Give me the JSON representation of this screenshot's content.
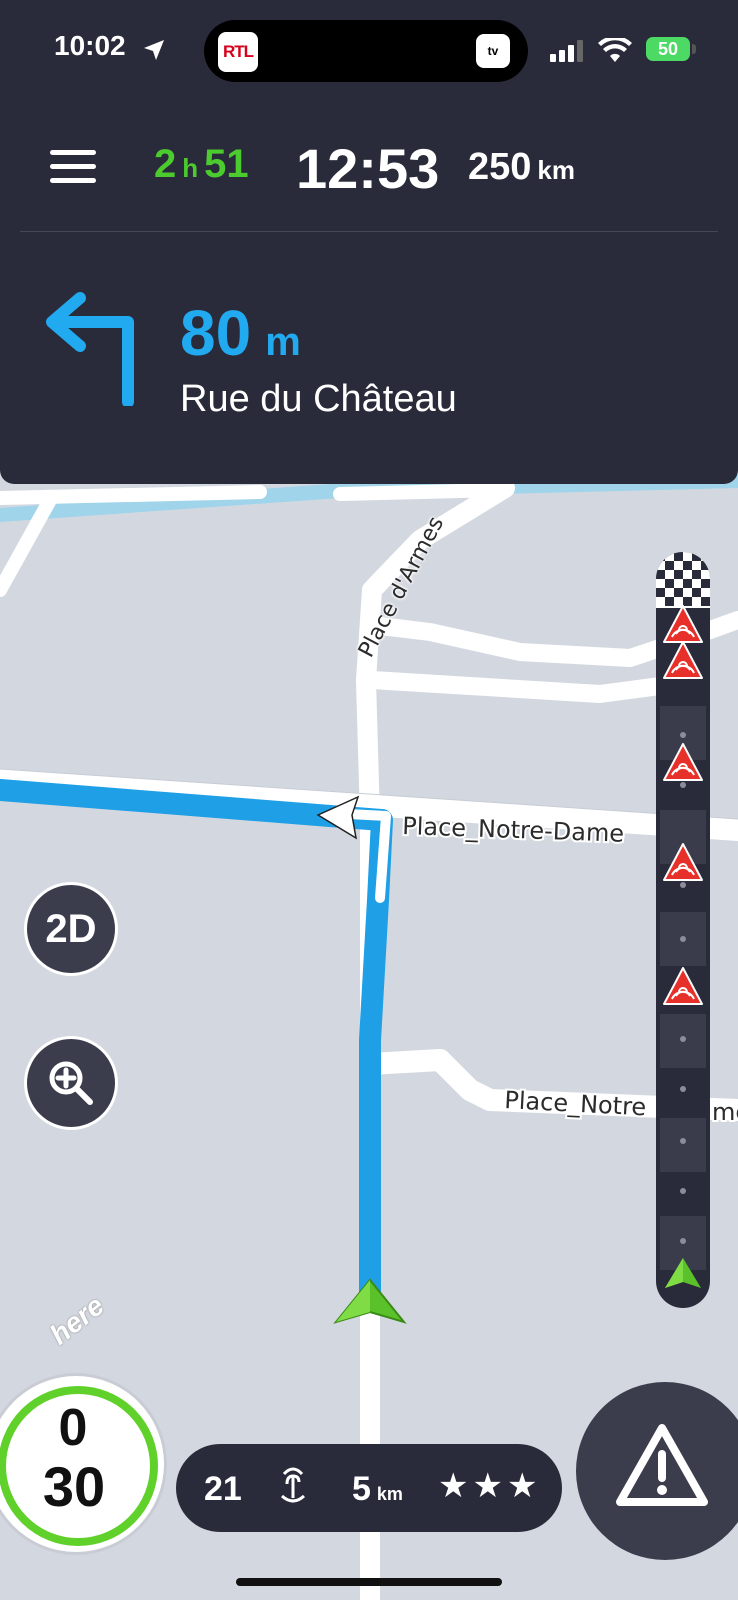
{
  "status_bar": {
    "time": "10:02",
    "island_app_badge": "RTL",
    "island_tv_badge": "tv",
    "battery": "50"
  },
  "trip": {
    "duration_hours": "2",
    "duration_h_unit": "h",
    "duration_minutes": "51",
    "eta": "12:53",
    "distance_value": "250",
    "distance_unit": "km"
  },
  "instruction": {
    "distance_value": "80",
    "distance_unit": "m",
    "street": "Rue du Château",
    "turn_icon": "turn-left-arrow-icon"
  },
  "map": {
    "labels": [
      "Place d'Armes",
      "Place_Notre-Dame",
      "Place_Notre",
      "me"
    ],
    "attribution": "here",
    "colors": {
      "route": "#21aaf0",
      "water": "#9fd4ea",
      "road": "#ffffff",
      "land": "#d3d8e0"
    }
  },
  "controls": {
    "view_mode": "2D",
    "zoom_icon": "zoom-in-icon"
  },
  "speed": {
    "current": "0",
    "limit": "30"
  },
  "info_pill": {
    "count": "21",
    "radar_icon": "radar-icon",
    "distance_value": "5",
    "distance_unit": "km",
    "rating": "★★★"
  },
  "alert_bar": {
    "icons": [
      "finish-flag-icon",
      "radar-warning-icon",
      "radar-warning-icon",
      "radar-warning-icon",
      "radar-warning-icon",
      "radar-warning-icon",
      "vehicle-icon"
    ]
  },
  "alert_button": {
    "icon": "warning-triangle-icon"
  }
}
